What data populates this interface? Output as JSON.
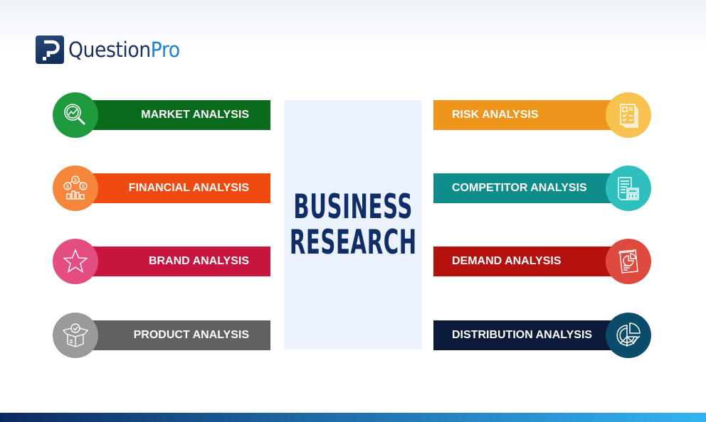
{
  "logo": {
    "brand_main": "Question",
    "brand_accent": "Pro"
  },
  "center": {
    "line1": "BUSINESS",
    "line2": "RESEARCH"
  },
  "left_items": [
    {
      "label": "MARKET ANALYSIS",
      "icon": "magnifier-trend-icon",
      "bar_color": "#0a6b1c",
      "circle_color": "#1f9b3e"
    },
    {
      "label": "FINANCIAL ANALYSIS",
      "icon": "money-chart-icon",
      "bar_color": "#f04a10",
      "circle_color": "#f6863b"
    },
    {
      "label": "BRAND ANALYSIS",
      "icon": "star-icon",
      "bar_color": "#c8153f",
      "circle_color": "#e34d82"
    },
    {
      "label": "PRODUCT ANALYSIS",
      "icon": "open-box-icon",
      "bar_color": "#616161",
      "circle_color": "#9a9a9a"
    }
  ],
  "right_items": [
    {
      "label": "RISK ANALYSIS",
      "icon": "checklist-document-icon",
      "bar_color": "#ef951b",
      "circle_color": "#f7c24e"
    },
    {
      "label": "COMPETITOR ANALYSIS",
      "icon": "document-calculator-icon",
      "bar_color": "#0e8d8a",
      "circle_color": "#2fc0bd"
    },
    {
      "label": "DEMAND ANALYSIS",
      "icon": "report-pie-icon",
      "bar_color": "#b5120f",
      "circle_color": "#df4a3e"
    },
    {
      "label": "DISTRIBUTION ANALYSIS",
      "icon": "pie-chart-icon",
      "bar_color": "#0a1a38",
      "circle_color": "#0b4c6b"
    }
  ]
}
